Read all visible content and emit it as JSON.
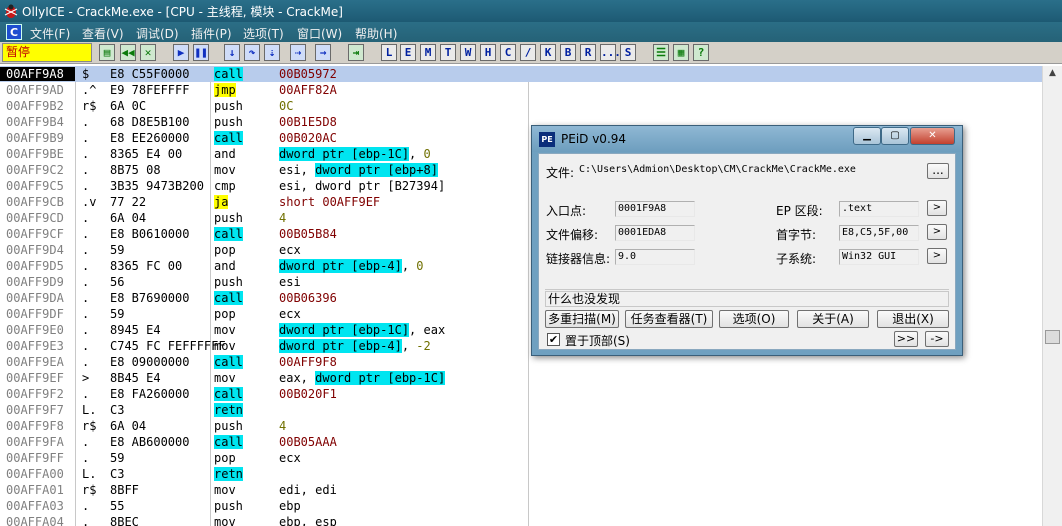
{
  "window": {
    "title": "OllyICE - CrackMe.exe - [CPU - 主线程, 模块 - CrackMe]"
  },
  "menu": [
    "文件(F)",
    "查看(V)",
    "调试(D)",
    "插件(P)",
    "选项(T)",
    "窗口(W)",
    "帮助(H)"
  ],
  "mdi_icon": "C",
  "toolbar": {
    "status": "暂停",
    "letters": [
      "L",
      "E",
      "M",
      "T",
      "W",
      "H",
      "C",
      "/",
      "K",
      "B",
      "R",
      "...",
      "S"
    ]
  },
  "disasm": {
    "rows": [
      {
        "addr": "00AFF9A8",
        "flow": "$",
        "hex": "E8 C55F0000",
        "mn": "call",
        "hl": "call",
        "op": [
          {
            "t": "00B05972",
            "c": "lit"
          }
        ],
        "selected": true
      },
      {
        "addr": "00AFF9AD",
        "flow": ".^",
        "hex": "E9 78FEFFFF",
        "mn": "jmp",
        "hl": "jmp",
        "op": [
          {
            "t": "00AFF82A",
            "c": "lit"
          }
        ]
      },
      {
        "addr": "00AFF9B2",
        "flow": "r$",
        "hex": "6A 0C",
        "mn": "push",
        "hl": "",
        "op": [
          {
            "t": "0C",
            "c": "num"
          }
        ]
      },
      {
        "addr": "00AFF9B4",
        "flow": ".",
        "hex": "68 D8E5B100",
        "mn": "push",
        "hl": "",
        "op": [
          {
            "t": "00B1E5D8",
            "c": "lit"
          }
        ]
      },
      {
        "addr": "00AFF9B9",
        "flow": ".",
        "hex": "E8 EE260000",
        "mn": "call",
        "hl": "call",
        "op": [
          {
            "t": "00B020AC",
            "c": "lit"
          }
        ]
      },
      {
        "addr": "00AFF9BE",
        "flow": ".",
        "hex": "8365 E4 00",
        "mn": "and",
        "hl": "",
        "op": [
          {
            "t": "dword ptr [ebp-1C]",
            "c": "mem"
          },
          {
            "t": ", ",
            "c": ""
          },
          {
            "t": "0",
            "c": "num"
          }
        ]
      },
      {
        "addr": "00AFF9C2",
        "flow": ".",
        "hex": "8B75 08",
        "mn": "mov",
        "hl": "",
        "op": [
          {
            "t": "esi, ",
            "c": ""
          },
          {
            "t": "dword ptr [ebp+8]",
            "c": "mem"
          }
        ]
      },
      {
        "addr": "00AFF9C5",
        "flow": ".",
        "hex": "3B35 9473B200",
        "mn": "cmp",
        "hl": "",
        "op": [
          {
            "t": "esi, dword ptr [B27394]",
            "c": ""
          }
        ]
      },
      {
        "addr": "00AFF9CB",
        "flow": ".v",
        "hex": "77 22",
        "mn": "ja",
        "hl": "jmp",
        "op": [
          {
            "t": "short 00AFF9EF",
            "c": "lit"
          }
        ]
      },
      {
        "addr": "00AFF9CD",
        "flow": ".",
        "hex": "6A 04",
        "mn": "push",
        "hl": "",
        "op": [
          {
            "t": "4",
            "c": "num"
          }
        ]
      },
      {
        "addr": "00AFF9CF",
        "flow": ".",
        "hex": "E8 B0610000",
        "mn": "call",
        "hl": "call",
        "op": [
          {
            "t": "00B05B84",
            "c": "lit"
          }
        ]
      },
      {
        "addr": "00AFF9D4",
        "flow": ".",
        "hex": "59",
        "mn": "pop",
        "hl": "",
        "op": [
          {
            "t": "ecx",
            "c": ""
          }
        ]
      },
      {
        "addr": "00AFF9D5",
        "flow": ".",
        "hex": "8365 FC 00",
        "mn": "and",
        "hl": "",
        "op": [
          {
            "t": "dword ptr [ebp-4]",
            "c": "mem"
          },
          {
            "t": ", ",
            "c": ""
          },
          {
            "t": "0",
            "c": "num"
          }
        ]
      },
      {
        "addr": "00AFF9D9",
        "flow": ".",
        "hex": "56",
        "mn": "push",
        "hl": "",
        "op": [
          {
            "t": "esi",
            "c": ""
          }
        ]
      },
      {
        "addr": "00AFF9DA",
        "flow": ".",
        "hex": "E8 B7690000",
        "mn": "call",
        "hl": "call",
        "op": [
          {
            "t": "00B06396",
            "c": "lit"
          }
        ]
      },
      {
        "addr": "00AFF9DF",
        "flow": ".",
        "hex": "59",
        "mn": "pop",
        "hl": "",
        "op": [
          {
            "t": "ecx",
            "c": ""
          }
        ]
      },
      {
        "addr": "00AFF9E0",
        "flow": ".",
        "hex": "8945 E4",
        "mn": "mov",
        "hl": "",
        "op": [
          {
            "t": "dword ptr [ebp-1C]",
            "c": "mem"
          },
          {
            "t": ", eax",
            "c": ""
          }
        ]
      },
      {
        "addr": "00AFF9E3",
        "flow": ".",
        "hex": "C745 FC FEFFFFFF",
        "mn": "mov",
        "hl": "",
        "op": [
          {
            "t": "dword ptr [ebp-4]",
            "c": "mem"
          },
          {
            "t": ", ",
            "c": ""
          },
          {
            "t": "-2",
            "c": "num"
          }
        ]
      },
      {
        "addr": "00AFF9EA",
        "flow": ".",
        "hex": "E8 09000000",
        "mn": "call",
        "hl": "call",
        "op": [
          {
            "t": "00AFF9F8",
            "c": "lit"
          }
        ]
      },
      {
        "addr": "00AFF9EF",
        "flow": ">",
        "hex": "8B45 E4",
        "mn": "mov",
        "hl": "",
        "op": [
          {
            "t": "eax, ",
            "c": ""
          },
          {
            "t": "dword ptr [ebp-1C]",
            "c": "mem"
          }
        ]
      },
      {
        "addr": "00AFF9F2",
        "flow": ".",
        "hex": "E8 FA260000",
        "mn": "call",
        "hl": "call",
        "op": [
          {
            "t": "00B020F1",
            "c": "lit"
          }
        ]
      },
      {
        "addr": "00AFF9F7",
        "flow": "L.",
        "hex": "C3",
        "mn": "retn",
        "hl": "call",
        "op": []
      },
      {
        "addr": "00AFF9F8",
        "flow": "r$",
        "hex": "6A 04",
        "mn": "push",
        "hl": "",
        "op": [
          {
            "t": "4",
            "c": "num"
          }
        ]
      },
      {
        "addr": "00AFF9FA",
        "flow": ".",
        "hex": "E8 AB600000",
        "mn": "call",
        "hl": "call",
        "op": [
          {
            "t": "00B05AAA",
            "c": "lit"
          }
        ]
      },
      {
        "addr": "00AFF9FF",
        "flow": ".",
        "hex": "59",
        "mn": "pop",
        "hl": "",
        "op": [
          {
            "t": "ecx",
            "c": ""
          }
        ]
      },
      {
        "addr": "00AFFA00",
        "flow": "L.",
        "hex": "C3",
        "mn": "retn",
        "hl": "call",
        "op": []
      },
      {
        "addr": "00AFFA01",
        "flow": "r$",
        "hex": "8BFF",
        "mn": "mov",
        "hl": "",
        "op": [
          {
            "t": "edi, edi",
            "c": ""
          }
        ]
      },
      {
        "addr": "00AFFA03",
        "flow": ".",
        "hex": "55",
        "mn": "push",
        "hl": "",
        "op": [
          {
            "t": "ebp",
            "c": ""
          }
        ]
      },
      {
        "addr": "00AFFA04",
        "flow": ".",
        "hex": "8BEC",
        "mn": "mov",
        "hl": "",
        "op": [
          {
            "t": "ebp, esp",
            "c": ""
          }
        ]
      }
    ]
  },
  "peid": {
    "title": "PEiD v0.94",
    "file_label": "文件:",
    "file_path": "C:\\Users\\Admion\\Desktop\\CM\\CrackMe\\CrackMe.exe",
    "browse": "...",
    "entry_label": "入口点:",
    "entry_value": "0001F9A8",
    "offset_label": "文件偏移:",
    "offset_value": "0001EDA8",
    "linker_label": "链接器信息:",
    "linker_value": "9.0",
    "ep_section_label": "EP 区段:",
    "ep_section_value": ".text",
    "first_bytes_label": "首字节:",
    "first_bytes_value": "E8,C5,5F,00",
    "subsystem_label": "子系统:",
    "subsystem_value": "Win32 GUI",
    "arrow": ">",
    "result": "什么也没发现",
    "buttons": [
      "多重扫描(M)",
      "任务查看器(T)",
      "选项(O)",
      "关于(A)",
      "退出(X)"
    ],
    "ontop_label": "置于顶部(S)",
    "nav_forward": ">>",
    "nav_arrow": "->"
  }
}
